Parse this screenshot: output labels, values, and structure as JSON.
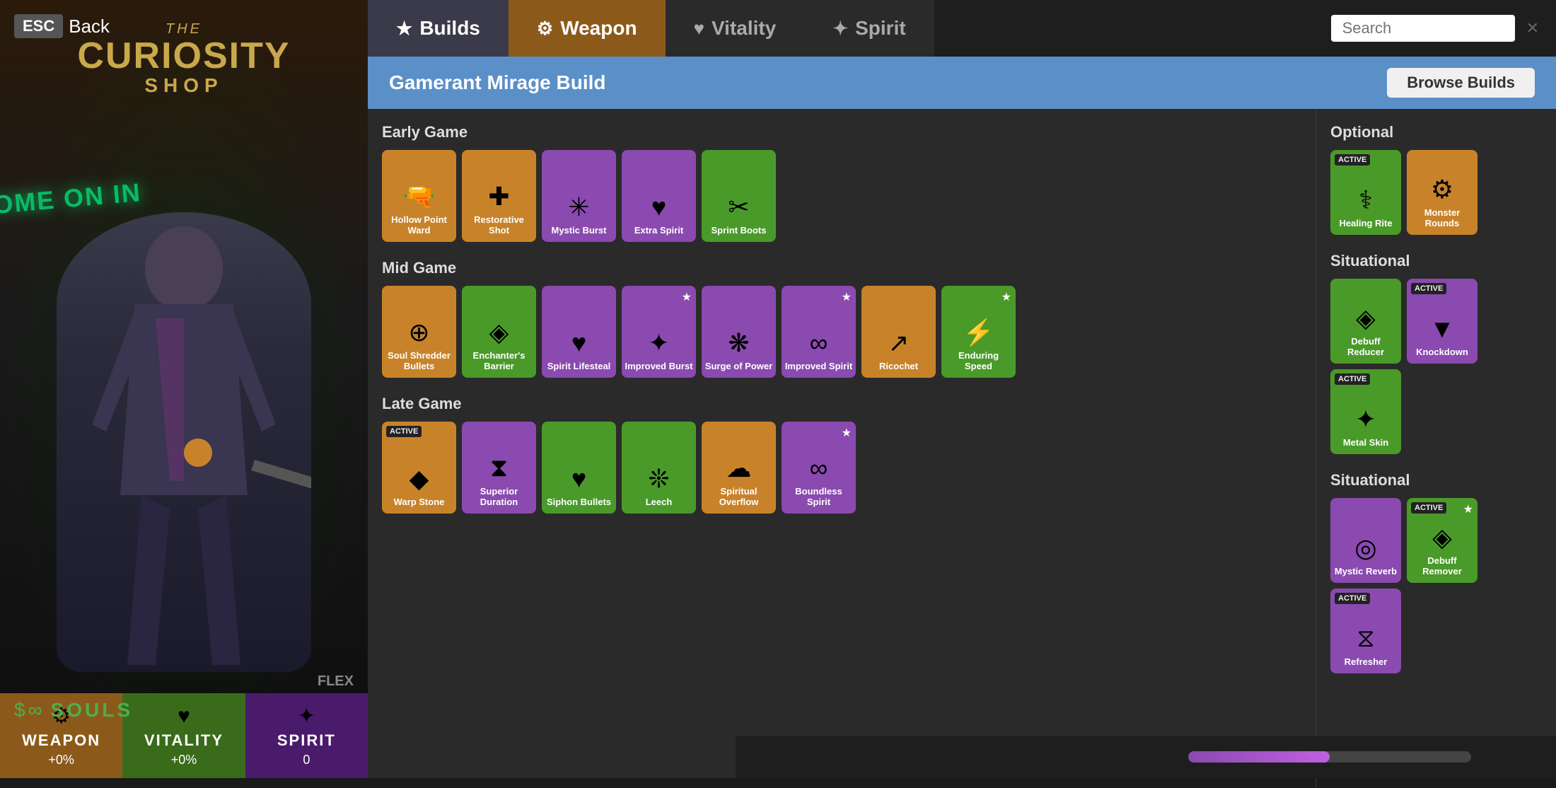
{
  "app": {
    "esc_label": "ESC",
    "back_label": "Back",
    "shop_the": "THE",
    "shop_curiosity": "CURIOSITY",
    "shop_shop": "SHOP"
  },
  "tabs": [
    {
      "id": "builds",
      "label": "Builds",
      "icon": "★",
      "active": false
    },
    {
      "id": "weapon",
      "label": "Weapon",
      "icon": "⚙",
      "active": true
    },
    {
      "id": "vitality",
      "label": "Vitality",
      "icon": "♥",
      "active": false
    },
    {
      "id": "spirit",
      "label": "Spirit",
      "icon": "✦",
      "active": false
    }
  ],
  "search": {
    "placeholder": "Search",
    "value": ""
  },
  "build": {
    "title": "Gamerant Mirage Build",
    "browse_builds_label": "Browse Builds"
  },
  "early_game": {
    "section_title": "Early Game",
    "items": [
      {
        "name": "Hollow Point Ward",
        "color": "orange",
        "icon": "🔫",
        "active": false
      },
      {
        "name": "Restorative Shot",
        "color": "orange",
        "icon": "✚",
        "active": false
      },
      {
        "name": "Mystic Burst",
        "color": "purple",
        "icon": "✳",
        "active": false
      },
      {
        "name": "Extra Spirit",
        "color": "purple",
        "icon": "♥",
        "active": false
      },
      {
        "name": "Sprint Boots",
        "color": "green",
        "icon": "✂",
        "active": false
      }
    ]
  },
  "mid_game": {
    "section_title": "Mid Game",
    "items": [
      {
        "name": "Soul Shredder Bullets",
        "color": "orange",
        "icon": "⊕",
        "active": false
      },
      {
        "name": "Enchanter's Barrier",
        "color": "green",
        "icon": "◈",
        "active": false
      },
      {
        "name": "Spirit Lifesteal",
        "color": "purple",
        "icon": "♥",
        "active": false
      },
      {
        "name": "Improved Burst",
        "color": "purple",
        "icon": "✦",
        "active": false,
        "star": true
      },
      {
        "name": "Surge of Power",
        "color": "purple",
        "icon": "❋",
        "active": false
      },
      {
        "name": "Improved Spirit",
        "color": "purple",
        "icon": "∞",
        "active": false,
        "star": true
      },
      {
        "name": "Ricochet",
        "color": "orange",
        "icon": "↗",
        "active": false
      },
      {
        "name": "Enduring Speed",
        "color": "green",
        "icon": "⚡",
        "active": false,
        "star": true
      }
    ]
  },
  "late_game": {
    "section_title": "Late Game",
    "items": [
      {
        "name": "Warp Stone",
        "color": "orange",
        "icon": "◆",
        "active": true
      },
      {
        "name": "Superior Duration",
        "color": "purple",
        "icon": "⧗",
        "active": false
      },
      {
        "name": "Siphon Bullets",
        "color": "green",
        "icon": "♥",
        "active": false
      },
      {
        "name": "Leech",
        "color": "green",
        "icon": "❊",
        "active": false
      },
      {
        "name": "Spiritual Overflow",
        "color": "orange",
        "icon": "☁",
        "active": false
      },
      {
        "name": "Boundless Spirit",
        "color": "purple",
        "icon": "∞",
        "active": false,
        "star": true
      }
    ]
  },
  "optional": {
    "section_title": "Optional",
    "items": [
      {
        "name": "Healing Rite",
        "color": "green",
        "icon": "⚕",
        "active": true
      },
      {
        "name": "Monster Rounds",
        "color": "orange",
        "icon": "⚙",
        "active": false
      }
    ]
  },
  "situational": {
    "section_title": "Situational",
    "items": [
      {
        "name": "Debuff Reducer",
        "color": "green",
        "icon": "◈",
        "active": false
      },
      {
        "name": "Knockdown",
        "color": "purple",
        "icon": "▼",
        "active": true
      },
      {
        "name": "Metal Skin",
        "color": "green",
        "icon": "✦",
        "active": true
      }
    ]
  },
  "situational2": {
    "section_title": "Situational",
    "items": [
      {
        "name": "Mystic Reverb",
        "color": "purple",
        "icon": "◎",
        "active": false
      },
      {
        "name": "Debuff Remover",
        "color": "green",
        "icon": "◈",
        "active": true,
        "star": true
      },
      {
        "name": "Refresher",
        "color": "purple",
        "icon": "⧖",
        "active": true
      }
    ]
  },
  "souls": {
    "label": "SOULS"
  },
  "stats": [
    {
      "id": "weapon",
      "label": "WEAPON",
      "value": "+0%",
      "icon": "⚙"
    },
    {
      "id": "vitality",
      "label": "VITALITY",
      "value": "+0%",
      "icon": "♥"
    },
    {
      "id": "spirit",
      "label": "SPIRIT",
      "value": "0",
      "icon": "✦"
    }
  ],
  "flex_label": "FLEX",
  "neon_text": "OME ON IN"
}
